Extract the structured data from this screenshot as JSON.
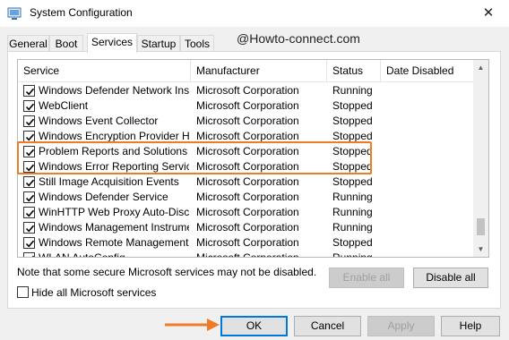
{
  "window": {
    "title": "System Configuration",
    "close_glyph": "✕"
  },
  "tabs": [
    "General",
    "Boot",
    "Services",
    "Startup",
    "Tools"
  ],
  "watermark": "@Howto-connect.com",
  "table": {
    "columns": [
      "Service",
      "Manufacturer",
      "Status",
      "Date Disabled"
    ],
    "rows": [
      {
        "service": "Windows Defender Network Ins...",
        "manufacturer": "Microsoft Corporation",
        "status": "Running",
        "checked": true
      },
      {
        "service": "WebClient",
        "manufacturer": "Microsoft Corporation",
        "status": "Stopped",
        "checked": true
      },
      {
        "service": "Windows Event Collector",
        "manufacturer": "Microsoft Corporation",
        "status": "Stopped",
        "checked": true
      },
      {
        "service": "Windows Encryption Provider Ho...",
        "manufacturer": "Microsoft Corporation",
        "status": "Stopped",
        "checked": true
      },
      {
        "service": "Problem Reports and Solutions C...",
        "manufacturer": "Microsoft Corporation",
        "status": "Stopped",
        "checked": true
      },
      {
        "service": "Windows Error Reporting Service",
        "manufacturer": "Microsoft Corporation",
        "status": "Stopped",
        "checked": true
      },
      {
        "service": "Still Image Acquisition Events",
        "manufacturer": "Microsoft Corporation",
        "status": "Stopped",
        "checked": true
      },
      {
        "service": "Windows Defender Service",
        "manufacturer": "Microsoft Corporation",
        "status": "Running",
        "checked": true
      },
      {
        "service": "WinHTTP Web Proxy Auto-Disco...",
        "manufacturer": "Microsoft Corporation",
        "status": "Running",
        "checked": true
      },
      {
        "service": "Windows Management Instrume...",
        "manufacturer": "Microsoft Corporation",
        "status": "Running",
        "checked": true
      },
      {
        "service": "Windows Remote Management (...",
        "manufacturer": "Microsoft Corporation",
        "status": "Stopped",
        "checked": true
      },
      {
        "service": "WLAN AutoConfig",
        "manufacturer": "Microsoft Corporation",
        "status": "Running",
        "checked": true
      }
    ]
  },
  "note": "Note that some secure Microsoft services may not be disabled.",
  "buttons": {
    "enable_all": "Enable all",
    "disable_all": "Disable all",
    "ok": "OK",
    "cancel": "Cancel",
    "apply": "Apply",
    "help": "Help"
  },
  "hide_ms": {
    "label": "Hide all Microsoft services",
    "checked": false
  },
  "colors": {
    "highlight": "#f07a26",
    "arrow": "#f07a26",
    "default_button_border": "#0078d7"
  }
}
